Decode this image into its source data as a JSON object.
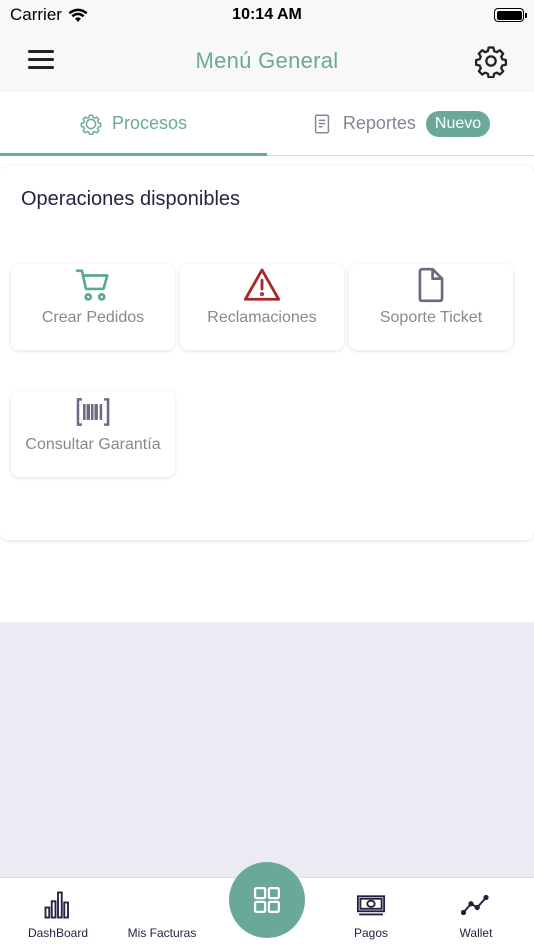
{
  "status_bar": {
    "carrier": "Carrier",
    "time": "10:14 AM"
  },
  "header": {
    "title": "Menú General"
  },
  "tabs": [
    {
      "label": "Procesos",
      "active": true
    },
    {
      "label": "Reportes",
      "active": false,
      "badge": "Nuevo"
    }
  ],
  "section": {
    "title": "Operaciones disponibles"
  },
  "tiles": [
    {
      "label": "Crear Pedidos",
      "icon": "cart-icon",
      "color": "#5aa996"
    },
    {
      "label": "Reclamaciones",
      "icon": "warning-icon",
      "color": "#a52a2a"
    },
    {
      "label": "Soporte Ticket",
      "icon": "document-icon",
      "color": "#6c6a80"
    },
    {
      "label": "Consultar Garantía",
      "icon": "barcode-icon",
      "color": "#6c6a80"
    }
  ],
  "bottom_nav": [
    {
      "label": "DashBoard",
      "icon": "bar-chart-icon"
    },
    {
      "label": "Mis Facturas",
      "icon": "invoice-icon"
    },
    {
      "label": "",
      "icon": "grid-icon"
    },
    {
      "label": "Pagos",
      "icon": "cash-icon"
    },
    {
      "label": "Wallet",
      "icon": "trend-line-icon"
    }
  ],
  "colors": {
    "accent": "#6aa99a",
    "warning": "#a52a2a",
    "text_dark": "#2a2140",
    "muted": "#8a8694"
  }
}
